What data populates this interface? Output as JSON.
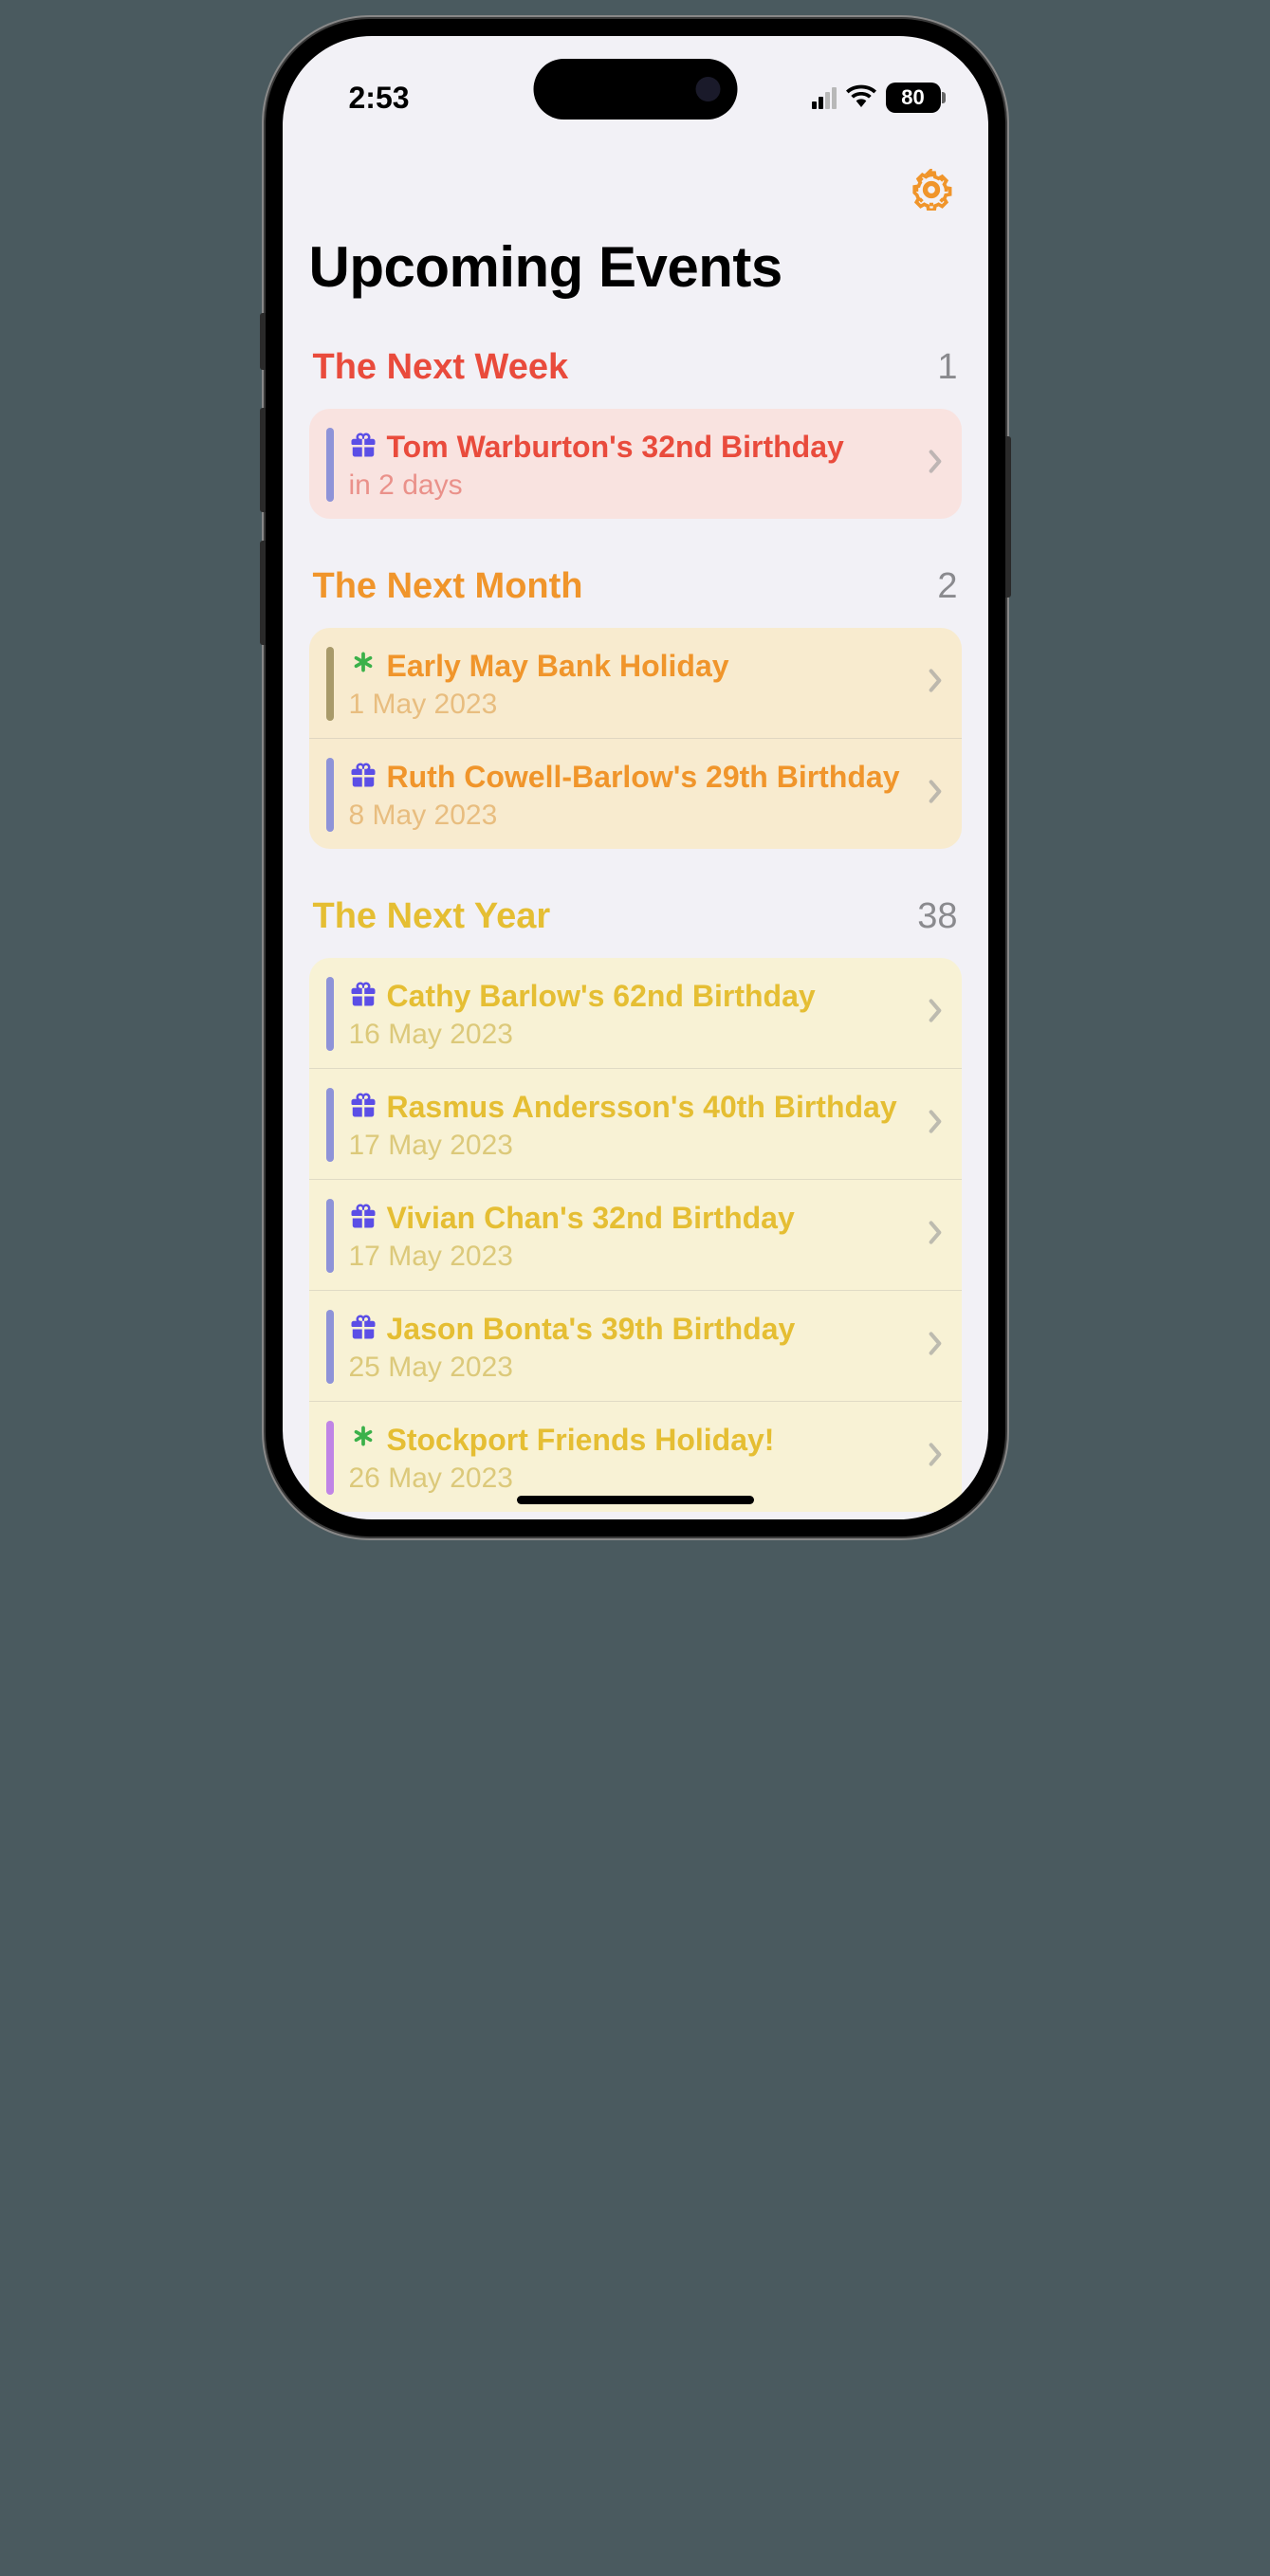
{
  "status": {
    "time": "2:53",
    "battery": "80"
  },
  "header": {
    "title": "Upcoming Events"
  },
  "icons": {
    "gift": "gift-icon",
    "asterisk": "asterisk-icon",
    "gear": "gear-icon",
    "chevron": "chevron-right-icon"
  },
  "colors": {
    "week_accent": "#e94b3c",
    "month_accent": "#f0952b",
    "year_accent": "#e5be33",
    "gift_icon": "#5b4ee6",
    "star_icon": "#3bb14a",
    "stripe_blue": "#8e93d8",
    "stripe_olive": "#a89a6a",
    "stripe_purple": "#c084e6"
  },
  "sections": [
    {
      "key": "week",
      "title": "The Next Week",
      "count": "1",
      "events": [
        {
          "icon": "gift",
          "stripe": "#8e93d8",
          "title": "Tom Warburton's 32nd Birthday",
          "sub": "in 2 days"
        }
      ]
    },
    {
      "key": "month",
      "title": "The Next Month",
      "count": "2",
      "events": [
        {
          "icon": "asterisk",
          "stripe": "#a89a6a",
          "title": "Early May Bank Holiday",
          "sub": "1 May 2023"
        },
        {
          "icon": "gift",
          "stripe": "#8e93d8",
          "title": "Ruth Cowell-Barlow's 29th Birthday",
          "sub": "8 May 2023"
        }
      ]
    },
    {
      "key": "year",
      "title": "The Next Year",
      "count": "38",
      "events": [
        {
          "icon": "gift",
          "stripe": "#8e93d8",
          "title": "Cathy Barlow's 62nd Birthday",
          "sub": "16 May 2023"
        },
        {
          "icon": "gift",
          "stripe": "#8e93d8",
          "title": "Rasmus Andersson's 40th Birthday",
          "sub": "17 May 2023"
        },
        {
          "icon": "gift",
          "stripe": "#8e93d8",
          "title": "Vivian Chan's 32nd Birthday",
          "sub": "17 May 2023"
        },
        {
          "icon": "gift",
          "stripe": "#8e93d8",
          "title": "Jason Bonta's 39th Birthday",
          "sub": "25 May 2023"
        },
        {
          "icon": "asterisk",
          "stripe": "#c084e6",
          "title": "Stockport Friends Holiday!",
          "sub": "26 May 2023"
        }
      ]
    }
  ]
}
